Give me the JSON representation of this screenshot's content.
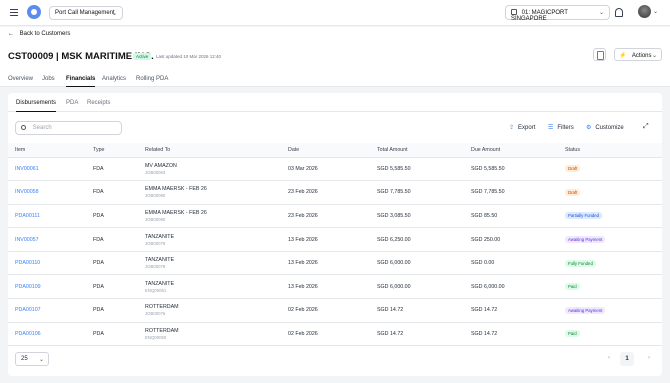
{
  "topbar": {
    "module_select": "Port Call Management",
    "port_select": "01: MAGICPORT SINGAPORE"
  },
  "header": {
    "back_label": "Back to Customers",
    "title": "CST00009 | MSK MARITIME INC.",
    "status": "Active",
    "last_updated": "Last updated 10 Mar 2026 12:40",
    "actions_label": "Actions"
  },
  "main_tabs": [
    "Overview",
    "Jobs",
    "Financials",
    "Analytics",
    "Rolling PDA"
  ],
  "active_main_tab": "Financials",
  "sub_tabs": [
    "Disbursements",
    "PDA",
    "Receipts"
  ],
  "active_sub_tab": "Disbursements",
  "toolbar": {
    "search_placeholder": "Search",
    "export_label": "Export",
    "filters_label": "Filters",
    "customize_label": "Customize"
  },
  "table": {
    "columns": [
      "Item",
      "Type",
      "Related To",
      "Date",
      "Total Amount",
      "Due Amount",
      "Status"
    ],
    "rows": [
      {
        "item": "INV00061",
        "type": "FDA",
        "related": "MV AMAZON",
        "related_sub": "JOB00063",
        "date": "03 Mar 2026",
        "total": "SGD 5,585.50",
        "due": "SGD 5,585.50",
        "status": "Draft",
        "status_kind": "draft"
      },
      {
        "item": "INV00058",
        "type": "FDA",
        "related": "EMMA MAERSK - FEB 26",
        "related_sub": "JOB00080",
        "date": "23 Feb 2026",
        "total": "SGD 7,785.50",
        "due": "SGD 7,785.50",
        "status": "Draft",
        "status_kind": "draft"
      },
      {
        "item": "PDA00111",
        "type": "PDA",
        "related": "EMMA MAERSK - FEB 26",
        "related_sub": "JOB00080",
        "date": "23 Feb 2026",
        "total": "SGD 3,085.50",
        "due": "SGD 85.50",
        "status": "Partially Funded",
        "status_kind": "partial"
      },
      {
        "item": "INV00057",
        "type": "FDA",
        "related": "TANZANITE",
        "related_sub": "JOB00078",
        "date": "13 Feb 2026",
        "total": "SGD 6,250.00",
        "due": "SGD 250.00",
        "status": "Awaiting Payment",
        "status_kind": "await"
      },
      {
        "item": "PDA00110",
        "type": "PDA",
        "related": "TANZANITE",
        "related_sub": "JOB00078",
        "date": "13 Feb 2026",
        "total": "SGD 6,000.00",
        "due": "SGD 0.00",
        "status": "Fully Funded",
        "status_kind": "funded"
      },
      {
        "item": "PDA00109",
        "type": "PDA",
        "related": "TANZANITE",
        "related_sub": "ENQ00051",
        "date": "13 Feb 2026",
        "total": "SGD 6,000.00",
        "due": "SGD 6,000.00",
        "status": "Paid",
        "status_kind": "paid"
      },
      {
        "item": "PDA00107",
        "type": "PDA",
        "related": "ROTTERDAM",
        "related_sub": "JOB00076",
        "date": "02 Feb 2026",
        "total": "SGD 14.72",
        "due": "SGD 14.72",
        "status": "Awaiting Payment",
        "status_kind": "await"
      },
      {
        "item": "PDA00106",
        "type": "PDA",
        "related": "ROTTERDAM",
        "related_sub": "ENQ00050",
        "date": "02 Feb 2026",
        "total": "SGD 14.72",
        "due": "SGD 14.72",
        "status": "Paid",
        "status_kind": "paid"
      }
    ]
  },
  "pagination": {
    "page_size": "25",
    "current_page": "1"
  }
}
